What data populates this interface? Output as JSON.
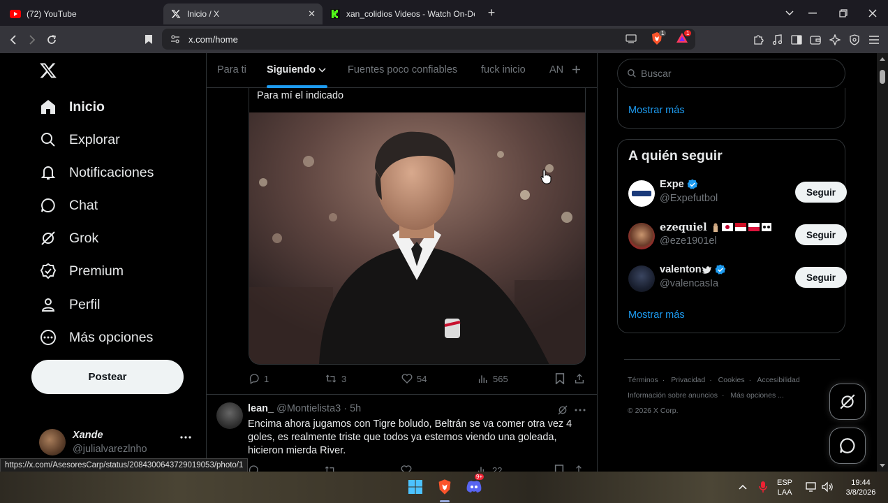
{
  "browser": {
    "tabs": [
      {
        "title": "(72) YouTube",
        "favicon": "youtube-icon",
        "active": false
      },
      {
        "title": "Inicio / X",
        "favicon": "x-logo-icon",
        "active": true
      },
      {
        "title": "xan_colidios Videos - Watch On-Dem",
        "favicon": "kick-icon",
        "active": false
      }
    ],
    "url": "x.com/home",
    "shield_badge": "1",
    "alert_badge": "1",
    "status_url": "https://x.com/AsesoresCarp/status/2084300643729019053/photo/1"
  },
  "nav": {
    "items": [
      {
        "label": "Inicio",
        "icon": "home-icon"
      },
      {
        "label": "Explorar",
        "icon": "search-icon"
      },
      {
        "label": "Notificaciones",
        "icon": "bell-icon"
      },
      {
        "label": "Chat",
        "icon": "chat-icon"
      },
      {
        "label": "Grok",
        "icon": "grok-icon"
      },
      {
        "label": "Premium",
        "icon": "premium-icon"
      },
      {
        "label": "Perfil",
        "icon": "profile-icon"
      },
      {
        "label": "Más opciones",
        "icon": "more-options-icon"
      }
    ],
    "post_button": "Postear",
    "profile": {
      "name": "Xande",
      "handle": "@julialvarezlnho"
    }
  },
  "timeline": {
    "tabs": [
      "Para ti",
      "Siguiendo",
      "Fuentes poco confiables",
      "fuck inicio",
      "AN"
    ],
    "active_tab": "Siguiendo",
    "quote_text": "Para mí el indicado",
    "tweet1_actions": {
      "replies": "1",
      "retweets": "3",
      "likes": "54",
      "views": "565"
    },
    "tweet2": {
      "name": "lean_",
      "handle": "@Montielista3",
      "time": "· 5h",
      "text": "Encima ahora jugamos con Tigre boludo, Beltrán se va comer otra vez 4 goles, es realmente triste que todos ya estemos viendo una goleada, hicieron mierda River.",
      "views": "22"
    }
  },
  "sidebar": {
    "search_placeholder": "Buscar",
    "show_more": "Mostrar más",
    "who_to_follow_title": "A quién seguir",
    "follow_button": "Seguir",
    "suggestions": [
      {
        "name": "Expe",
        "handle": "@Expefutbol",
        "verified": true
      },
      {
        "name": "ezequiel",
        "handle": "@eze1901el",
        "verified": false
      },
      {
        "name": "valenton",
        "handle": "@valencasIa",
        "verified": true
      }
    ],
    "show_more_2": "Mostrar más",
    "footer": {
      "links": [
        "Términos",
        "Privacidad",
        "Cookies",
        "Accesibilidad",
        "Información sobre anuncios",
        "Más opciones ..."
      ],
      "copyright": "© 2026 X Corp."
    }
  },
  "taskbar": {
    "lang": "ESP",
    "layout": "LAA",
    "time": "19:44",
    "date": "3/8/2026",
    "discord_badge": "9+"
  },
  "colors": {
    "accent": "#1d9bf0",
    "background": "#000000",
    "border": "#2f3336"
  }
}
